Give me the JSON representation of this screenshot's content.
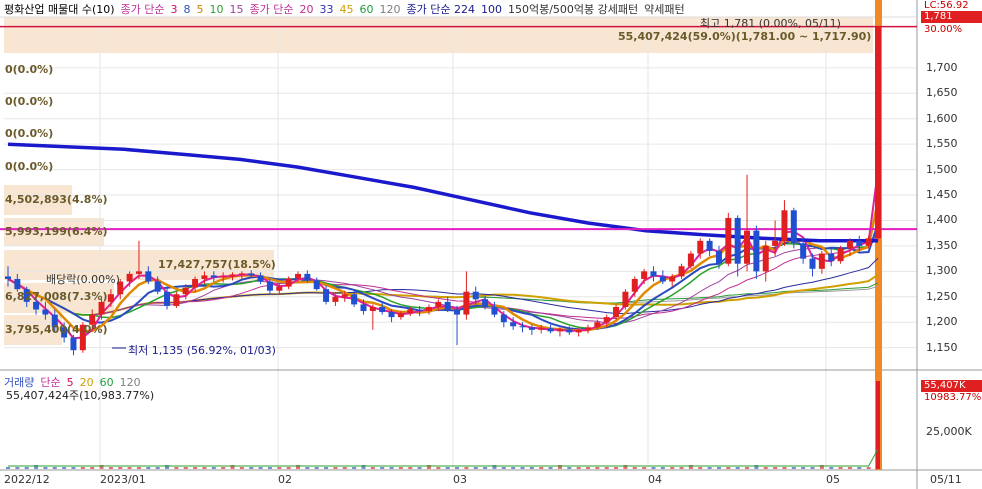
{
  "legend": {
    "items": [
      {
        "text": "평화산업 매물대 수(10)",
        "color": "#000000"
      },
      {
        "text": "종가 단순",
        "color": "#c0309a"
      },
      {
        "text": "3",
        "color": "#d01060"
      },
      {
        "text": "8",
        "color": "#3050c0"
      },
      {
        "text": "5",
        "color": "#d08000"
      },
      {
        "text": "10",
        "color": "#30a030"
      },
      {
        "text": "15",
        "color": "#a040a0"
      },
      {
        "text": "종가 단순",
        "color": "#c0309a"
      },
      {
        "text": "20",
        "color": "#c03090"
      },
      {
        "text": "33",
        "color": "#3030b0"
      },
      {
        "text": "45",
        "color": "#d0a000"
      },
      {
        "text": "60",
        "color": "#20a040"
      },
      {
        "text": "120",
        "color": "#808080"
      },
      {
        "text": "종가 단순 224",
        "color": "#1a1a8c"
      },
      {
        "text": "100",
        "color": "#1a1a8c"
      },
      {
        "text": "150억봉/500억봉 강세패턴",
        "color": "#333333"
      },
      {
        "text": "약세패턴",
        "color": "#333333"
      }
    ]
  },
  "annotations": {
    "high": "최고 1,781 (0.00%, 05/11)",
    "high_range": "55,407,424(59.0%)(1,781.00 ~ 1,717.90)",
    "low": "최저 1,135 (56.92%, 01/03)",
    "dividend": "배당락(0.00%)",
    "last_price_tag": "1,781",
    "top_right_tag": "LC:56.92",
    "pct_tag": "30.00%",
    "vol_tag": "55,407K",
    "vol_pct_tag": "10983.77%"
  },
  "volume_profile": {
    "labels": [
      "0(0.0%)",
      "0(0.0%)",
      "0(0.0%)",
      "0(0.0%)",
      "4,502,893(4.8%)",
      "5,993,199(6.4%)",
      "17,427,757(18.5%)",
      "6,827,008(7.3%)",
      "3,795,400(4.0%)"
    ]
  },
  "volume_panel": {
    "legend": [
      {
        "text": "거래량",
        "color": "#3050c0"
      },
      {
        "text": "단순",
        "color": "#c0309a"
      },
      {
        "text": "5",
        "color": "#d01060"
      },
      {
        "text": "20",
        "color": "#d0a000"
      },
      {
        "text": "60",
        "color": "#20a040"
      },
      {
        "text": "120",
        "color": "#808080"
      }
    ],
    "value_text": "55,407,424주(10,983.77%)",
    "axis_label": "25,000K"
  },
  "y_axis": {
    "ticks": [
      "1,700",
      "1,650",
      "1,600",
      "1,550",
      "1,500",
      "1,450",
      "1,400",
      "1,350",
      "1,300",
      "1,250",
      "1,200",
      "1,150"
    ]
  },
  "x_axis": {
    "ticks": [
      "2022/12",
      "2023/01",
      "02",
      "03",
      "04",
      "05",
      "05/11"
    ]
  },
  "chart_data": {
    "type": "candlestick",
    "ylim": [
      1110,
      1800
    ],
    "resistance_line": 1383,
    "high_line": 1781,
    "candles": [
      [
        1290,
        1310,
        1270,
        1285
      ],
      [
        1285,
        1295,
        1260,
        1265
      ],
      [
        1265,
        1270,
        1230,
        1240
      ],
      [
        1240,
        1255,
        1215,
        1225
      ],
      [
        1225,
        1240,
        1205,
        1215
      ],
      [
        1215,
        1225,
        1180,
        1190
      ],
      [
        1190,
        1200,
        1160,
        1170
      ],
      [
        1170,
        1175,
        1135,
        1145
      ],
      [
        1145,
        1200,
        1140,
        1195
      ],
      [
        1195,
        1225,
        1185,
        1215
      ],
      [
        1215,
        1245,
        1205,
        1240
      ],
      [
        1240,
        1265,
        1230,
        1255
      ],
      [
        1255,
        1285,
        1245,
        1280
      ],
      [
        1280,
        1300,
        1270,
        1295
      ],
      [
        1295,
        1360,
        1285,
        1300
      ],
      [
        1300,
        1310,
        1275,
        1280
      ],
      [
        1280,
        1290,
        1255,
        1260
      ],
      [
        1260,
        1270,
        1225,
        1232
      ],
      [
        1232,
        1260,
        1228,
        1255
      ],
      [
        1255,
        1275,
        1245,
        1268
      ],
      [
        1268,
        1290,
        1260,
        1285
      ],
      [
        1285,
        1300,
        1275,
        1292
      ],
      [
        1292,
        1300,
        1280,
        1288
      ],
      [
        1288,
        1298,
        1278,
        1290
      ],
      [
        1290,
        1298,
        1282,
        1294
      ],
      [
        1294,
        1300,
        1285,
        1296
      ],
      [
        1296,
        1302,
        1288,
        1292
      ],
      [
        1292,
        1298,
        1275,
        1280
      ],
      [
        1280,
        1285,
        1255,
        1262
      ],
      [
        1262,
        1275,
        1255,
        1270
      ],
      [
        1270,
        1290,
        1265,
        1286
      ],
      [
        1286,
        1300,
        1280,
        1295
      ],
      [
        1295,
        1302,
        1278,
        1282
      ],
      [
        1282,
        1288,
        1262,
        1265
      ],
      [
        1265,
        1272,
        1235,
        1240
      ],
      [
        1240,
        1255,
        1232,
        1250
      ],
      [
        1250,
        1262,
        1240,
        1255
      ],
      [
        1255,
        1262,
        1230,
        1235
      ],
      [
        1235,
        1245,
        1215,
        1222
      ],
      [
        1222,
        1235,
        1185,
        1230
      ],
      [
        1230,
        1240,
        1215,
        1220
      ],
      [
        1220,
        1225,
        1200,
        1210
      ],
      [
        1210,
        1222,
        1205,
        1218
      ],
      [
        1218,
        1230,
        1212,
        1225
      ],
      [
        1225,
        1232,
        1212,
        1222
      ],
      [
        1222,
        1235,
        1215,
        1230
      ],
      [
        1230,
        1245,
        1222,
        1240
      ],
      [
        1240,
        1250,
        1220,
        1225
      ],
      [
        1225,
        1232,
        1155,
        1215
      ],
      [
        1215,
        1300,
        1205,
        1260
      ],
      [
        1260,
        1270,
        1235,
        1245
      ],
      [
        1245,
        1252,
        1225,
        1230
      ],
      [
        1230,
        1240,
        1210,
        1215
      ],
      [
        1215,
        1222,
        1190,
        1200
      ],
      [
        1200,
        1210,
        1185,
        1192
      ],
      [
        1192,
        1200,
        1180,
        1190
      ],
      [
        1190,
        1195,
        1175,
        1185
      ],
      [
        1185,
        1195,
        1178,
        1188
      ],
      [
        1188,
        1195,
        1178,
        1182
      ],
      [
        1182,
        1190,
        1172,
        1186
      ],
      [
        1186,
        1192,
        1175,
        1180
      ],
      [
        1180,
        1188,
        1172,
        1185
      ],
      [
        1185,
        1195,
        1178,
        1190
      ],
      [
        1190,
        1205,
        1185,
        1200
      ],
      [
        1200,
        1215,
        1190,
        1210
      ],
      [
        1210,
        1235,
        1205,
        1230
      ],
      [
        1230,
        1265,
        1225,
        1260
      ],
      [
        1260,
        1290,
        1250,
        1285
      ],
      [
        1285,
        1305,
        1275,
        1300
      ],
      [
        1300,
        1310,
        1280,
        1290
      ],
      [
        1290,
        1302,
        1275,
        1280
      ],
      [
        1280,
        1295,
        1270,
        1290
      ],
      [
        1290,
        1315,
        1285,
        1310
      ],
      [
        1310,
        1340,
        1305,
        1335
      ],
      [
        1335,
        1365,
        1325,
        1360
      ],
      [
        1360,
        1365,
        1330,
        1340
      ],
      [
        1340,
        1350,
        1305,
        1315
      ],
      [
        1315,
        1415,
        1310,
        1405
      ],
      [
        1405,
        1410,
        1290,
        1315
      ],
      [
        1315,
        1490,
        1300,
        1380
      ],
      [
        1380,
        1390,
        1285,
        1300
      ],
      [
        1300,
        1360,
        1280,
        1350
      ],
      [
        1350,
        1400,
        1330,
        1360
      ],
      [
        1360,
        1440,
        1350,
        1420
      ],
      [
        1420,
        1425,
        1345,
        1355
      ],
      [
        1355,
        1365,
        1315,
        1325
      ],
      [
        1325,
        1335,
        1290,
        1305
      ],
      [
        1305,
        1340,
        1295,
        1335
      ],
      [
        1335,
        1345,
        1310,
        1320
      ],
      [
        1320,
        1350,
        1315,
        1345
      ],
      [
        1345,
        1365,
        1330,
        1360
      ],
      [
        1360,
        1370,
        1340,
        1350
      ],
      [
        1350,
        1370,
        1345,
        1365
      ],
      [
        1365,
        1781,
        1360,
        1781
      ]
    ]
  }
}
